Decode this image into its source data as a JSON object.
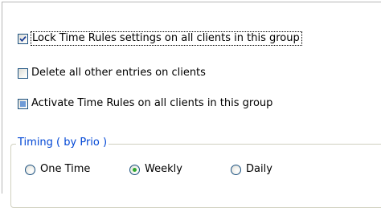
{
  "options": {
    "lock_settings": {
      "label": "Lock Time Rules settings on all clients in this group",
      "state": "checked"
    },
    "delete_entries": {
      "label": "Delete all other entries on clients",
      "state": "unchecked"
    },
    "activate_rules": {
      "label": "Activate Time Rules on all clients in this group",
      "state": "indeterminate"
    }
  },
  "timing": {
    "title": "Timing ( by Prio )",
    "selected": "Weekly",
    "one_time_label": "One Time",
    "weekly_label": "Weekly",
    "daily_label": "Daily"
  },
  "colors": {
    "check_mark": "#1c3e96",
    "indeterminate_fill": "#6f9bd7",
    "radio_dot": "#2fa830",
    "group_title": "#0046d5"
  }
}
